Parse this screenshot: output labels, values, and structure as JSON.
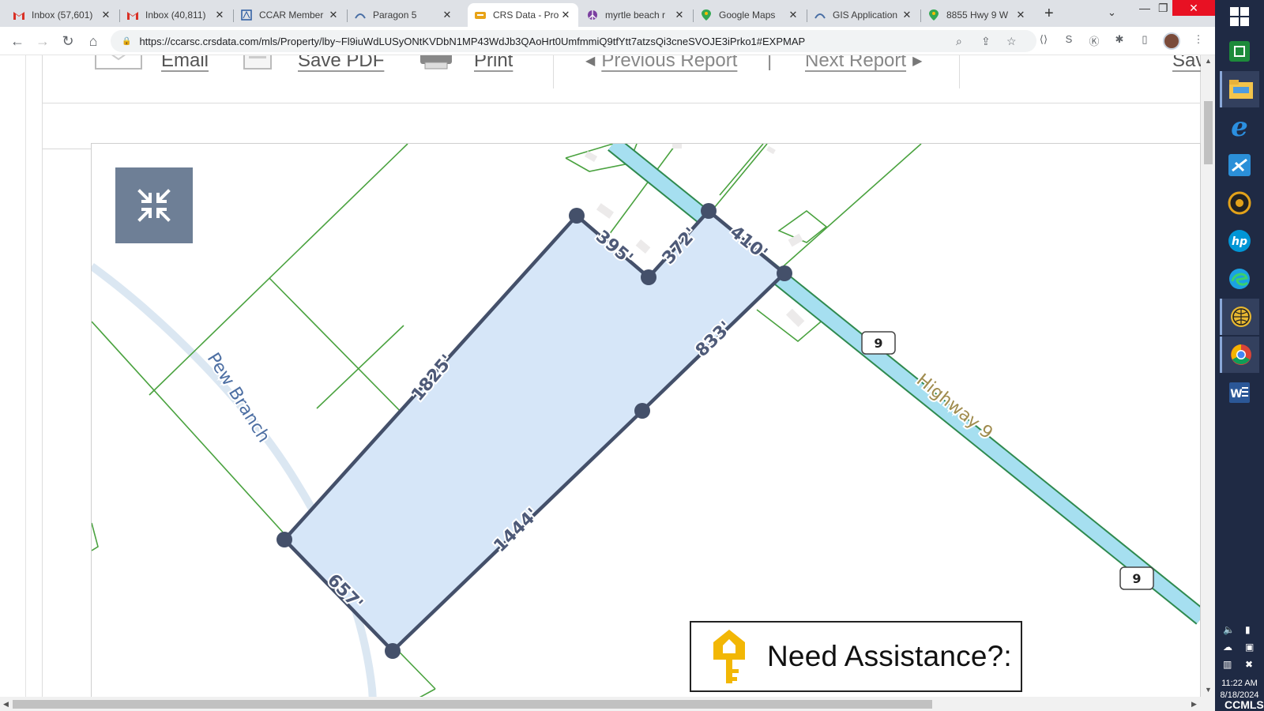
{
  "browser": {
    "tabs": [
      {
        "title": "Inbox (57,601)",
        "icon": "gmail-icon",
        "active": false
      },
      {
        "title": "Inbox (40,811)",
        "icon": "gmail-icon",
        "active": false
      },
      {
        "title": "CCAR Member",
        "icon": "ccar-icon",
        "active": false
      },
      {
        "title": "Paragon 5",
        "icon": "paragon-icon",
        "active": false
      },
      {
        "title": "CRS Data - Pro",
        "icon": "crs-icon",
        "active": true
      },
      {
        "title": "myrtle beach r",
        "icon": "peace-icon",
        "active": false
      },
      {
        "title": "Google Maps",
        "icon": "maps-icon",
        "active": false
      },
      {
        "title": "GIS Application",
        "icon": "gis-icon",
        "active": false
      },
      {
        "title": "8855 Hwy 9 W",
        "icon": "maps-icon",
        "active": false
      }
    ],
    "url": "https://ccarsc.crsdata.com/mls/Property/lby~Fl9iuWdLUSyONtKVDbN1MP43WdJb3QAoHrt0UmfmmiQ9tfYtt7atzsQi3cneSVOJE3iPrko1#EXPMAP"
  },
  "report_toolbar": {
    "email": "Email",
    "save_pdf": "Save PDF",
    "print": "Print",
    "previous": "Previous Report",
    "separator": "|",
    "next": "Next Report",
    "save_partial": "Sav"
  },
  "map": {
    "stream_name": "Pew Branch",
    "road_name": "Highway 9",
    "route_shield": "9",
    "dimensions": [
      "395'",
      "372'",
      "410'",
      "833'",
      "1444'",
      "657'",
      "1825'"
    ]
  },
  "assist": {
    "text": "Need Assistance?:"
  },
  "system": {
    "time": "11:22 AM",
    "date": "8/18/2024",
    "watermark": "CCMLS"
  },
  "colors": {
    "parcel_fill": "#d6e6f8",
    "parcel_stroke": "#44506a",
    "lot_lines": "#4aa23f",
    "highway_fill": "#a6dff0",
    "highway_edge": "#2f8a4f",
    "accent_tab_close": "#e81123"
  }
}
